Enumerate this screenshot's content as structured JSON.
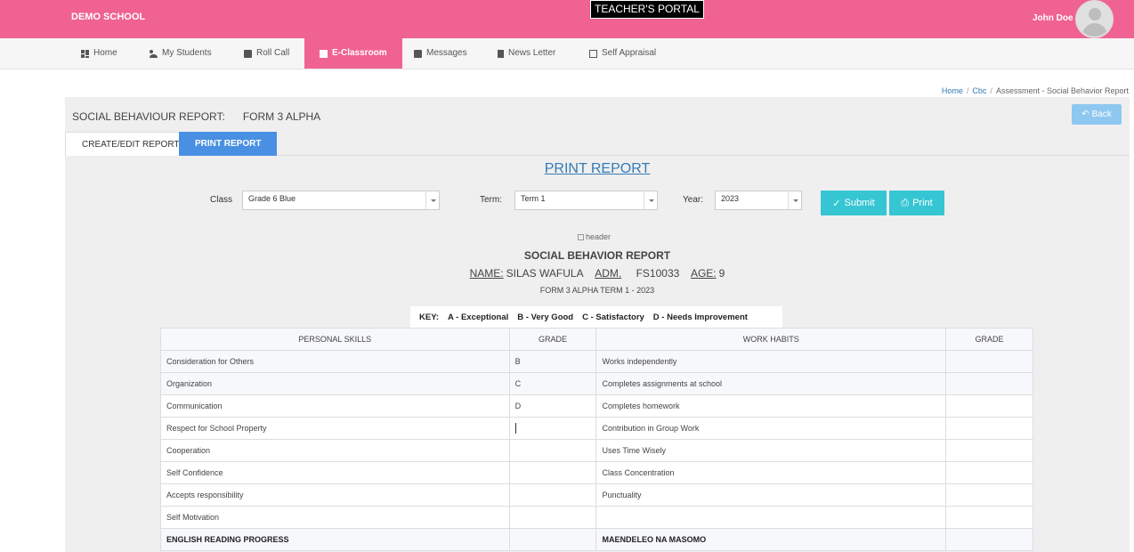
{
  "topbar": {
    "brand": "DEMO SCHOOL",
    "portal_title": "TEACHER'S PORTAL",
    "user_name": "John Doe -"
  },
  "nav": [
    {
      "label": "Home",
      "icon": "home-icon"
    },
    {
      "label": "My Students",
      "icon": "users-icon"
    },
    {
      "label": "Roll Call",
      "icon": "id-card-icon"
    },
    {
      "label": "E-Classroom",
      "icon": "check-square-icon",
      "active": true
    },
    {
      "label": "Messages",
      "icon": "message-icon"
    },
    {
      "label": "News Letter",
      "icon": "document-icon"
    },
    {
      "label": "Self Appraisal",
      "icon": "check-square-icon"
    }
  ],
  "breadcrumb": {
    "home": "Home",
    "cbc": "Cbc",
    "current": "Assessment - Social Behavior Report"
  },
  "page": {
    "title": "SOCIAL BEHAVIOUR REPORT:",
    "form": "FORM 3 ALPHA",
    "back_label": "Back"
  },
  "tabs": {
    "create_edit": "CREATE/EDIT REPORT",
    "print": "PRINT REPORT"
  },
  "print_heading": "PRINT REPORT",
  "filters": {
    "class_label": "Class",
    "class_value": "Grade 6 Blue",
    "term_label": "Term:",
    "term_value": "Term 1",
    "year_label": "Year:",
    "year_value": "2023",
    "submit_label": "Submit",
    "print_label": "Print"
  },
  "report": {
    "header_alt": "header",
    "title": "SOCIAL BEHAVIOR REPORT",
    "name_label": "NAME:",
    "name_value": "SILAS WAFULA",
    "adm_label": "ADM.",
    "adm_value": "FS10033",
    "age_label": "AGE:",
    "age_value": "9",
    "subtitle": "FORM 3 ALPHA TERM 1 - 2023"
  },
  "key": {
    "label": "KEY:",
    "items": [
      "A - Exceptional",
      "B - Very Good",
      "C - Satisfactory",
      "D - Needs Improvement"
    ]
  },
  "table": {
    "headers": [
      "PERSONAL SKILLS",
      "GRADE",
      "WORK HABITS",
      "GRADE"
    ],
    "rows": [
      {
        "skill": "Consideration for Others",
        "grade": "B",
        "habit": "Works independently",
        "habit_grade": ""
      },
      {
        "skill": "Organization",
        "grade": "C",
        "habit": "Completes assignments at school",
        "habit_grade": ""
      },
      {
        "skill": "Communication",
        "grade": "D",
        "habit": "Completes homework",
        "habit_grade": ""
      },
      {
        "skill": "Respect for School Property",
        "grade": "",
        "habit": "Contribution in Group Work",
        "habit_grade": ""
      },
      {
        "skill": "Cooperation",
        "grade": "",
        "habit": "Uses Time Wisely",
        "habit_grade": ""
      },
      {
        "skill": "Self Confidence",
        "grade": "",
        "habit": "Class Concentration",
        "habit_grade": ""
      },
      {
        "skill": "Accepts responsibility",
        "grade": "",
        "habit": "Punctuality",
        "habit_grade": ""
      },
      {
        "skill": "Self Motivation",
        "grade": "",
        "habit": "",
        "habit_grade": ""
      },
      {
        "skill": "ENGLISH READING PROGRESS",
        "grade": "",
        "habit": "MAENDELEO NA MASOMO",
        "habit_grade": ""
      }
    ]
  }
}
